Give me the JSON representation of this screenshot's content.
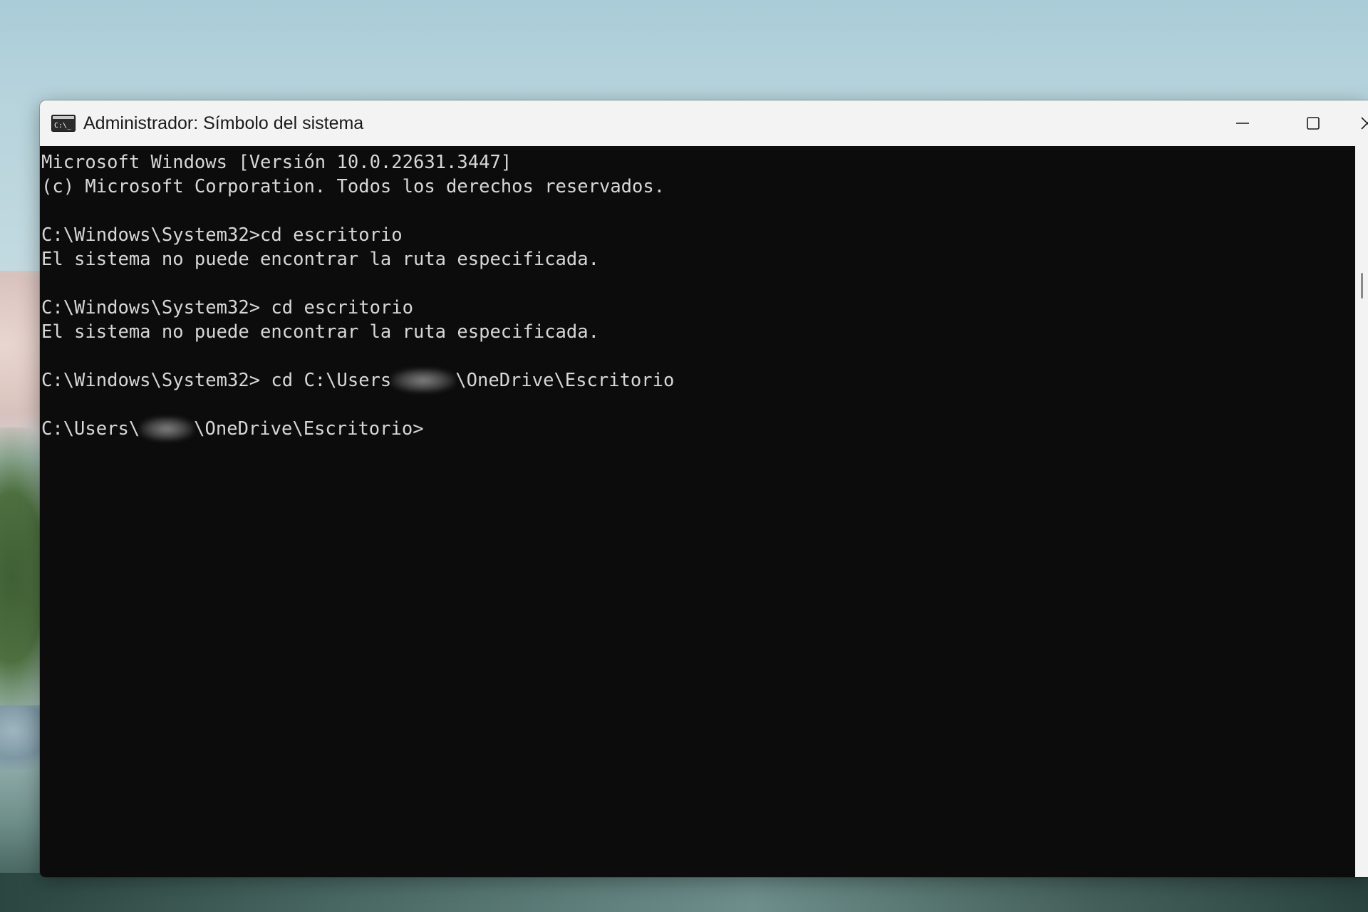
{
  "window": {
    "title": "Administrador: Símbolo del sistema",
    "icon": "command-prompt-icon",
    "controls": {
      "minimize_icon": "minimize-icon",
      "maximize_icon": "maximize-icon",
      "close_icon": "close-icon"
    }
  },
  "console": {
    "lines": [
      "Microsoft Windows [Versión 10.0.22631.3447]",
      "(c) Microsoft Corporation. Todos los derechos reservados.",
      "",
      "C:\\Windows\\System32>cd escritorio",
      "El sistema no puede encontrar la ruta especificada.",
      "",
      "C:\\Windows\\System32> cd escritorio",
      "El sistema no puede encontrar la ruta especificada.",
      ""
    ],
    "cmd3": {
      "before": "C:\\Windows\\System32> cd C:\\Users",
      "after": "\\OneDrive\\Escritorio"
    },
    "prompt": {
      "before": "C:\\Users\\",
      "after": "\\OneDrive\\Escritorio>"
    }
  },
  "colors": {
    "console_bg": "#0c0c0c",
    "console_text": "#d7d7d7",
    "titlebar_bg": "#f3f3f3"
  }
}
